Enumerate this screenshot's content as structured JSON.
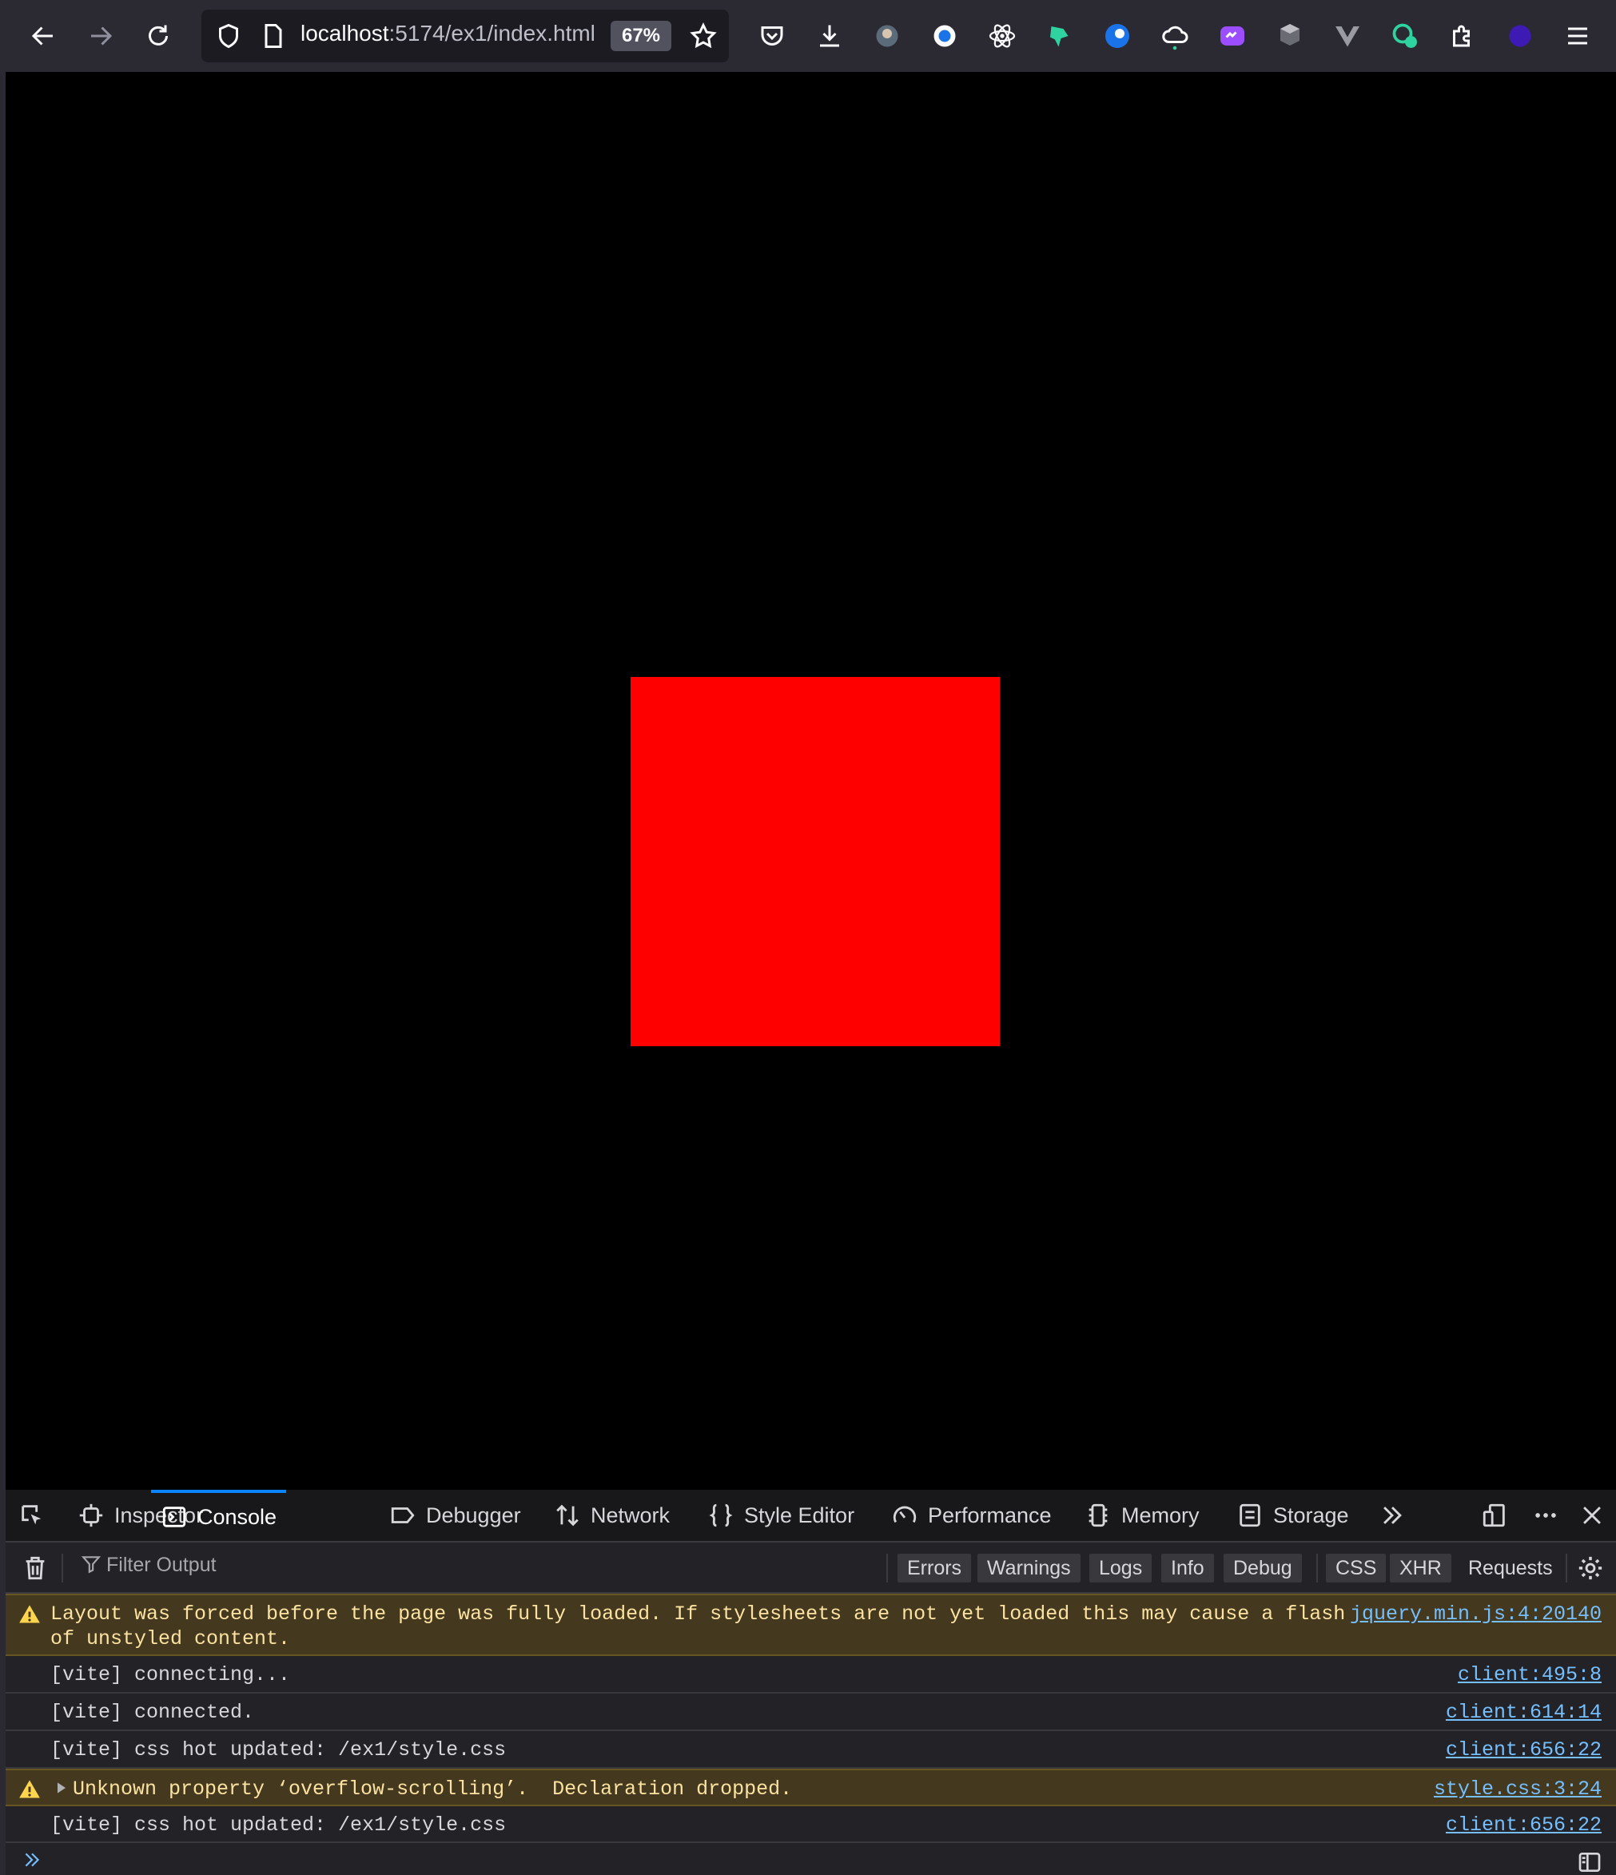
{
  "browser": {
    "url_host": "localhost",
    "url_path": ":5174/ex1/index.html",
    "zoom_label": "67%"
  },
  "page": {
    "box_color": "#ff0000",
    "background": "#000000"
  },
  "devtools": {
    "tabs": [
      "Inspector",
      "Console",
      "Debugger",
      "Network",
      "Style Editor",
      "Performance",
      "Memory",
      "Storage"
    ],
    "active_tab": "Console",
    "filter_placeholder": "Filter Output",
    "filter_buttons": [
      "Errors",
      "Warnings",
      "Logs",
      "Info",
      "Debug"
    ],
    "net_buttons": [
      "CSS",
      "XHR",
      "Requests"
    ],
    "messages": [
      {
        "type": "warning",
        "text": "Layout was forced before the page was fully loaded. If stylesheets are not yet loaded this may cause a flash\nof unstyled content.",
        "source": "jquery.min.js:4:20140"
      },
      {
        "type": "log",
        "text": "[vite] connecting...",
        "source": "client:495:8"
      },
      {
        "type": "log",
        "text": "[vite] connected.",
        "source": "client:614:14"
      },
      {
        "type": "log",
        "text": "[vite] css hot updated: /ex1/style.css",
        "source": "client:656:22"
      },
      {
        "type": "warning",
        "text": "Unknown property ‘overflow-scrolling’.  Declaration dropped.",
        "source": "style.css:3:24"
      },
      {
        "type": "log",
        "text": "[vite] css hot updated: /ex1/style.css",
        "source": "client:656:22"
      }
    ]
  }
}
